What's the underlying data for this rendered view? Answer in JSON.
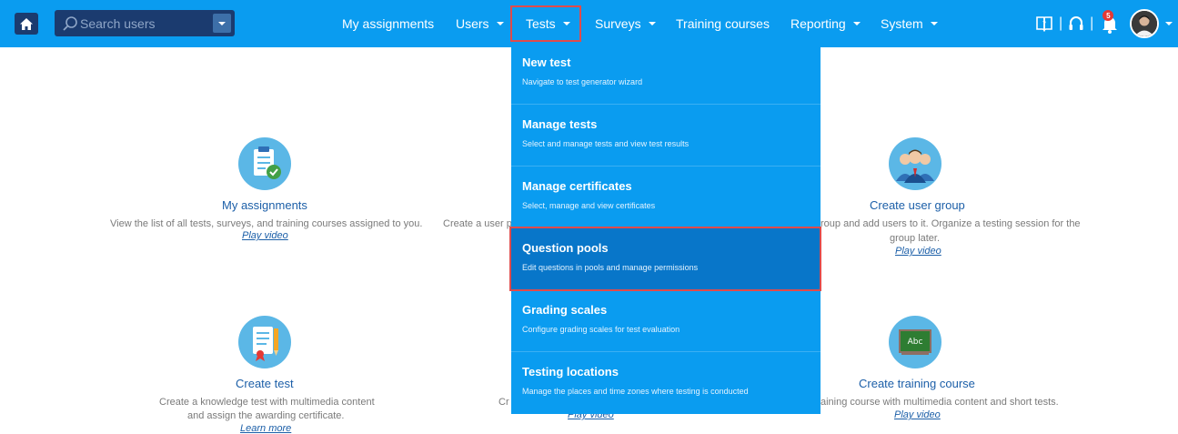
{
  "search": {
    "placeholder": "Search users"
  },
  "nav": {
    "my_assignments": "My assignments",
    "users": "Users",
    "tests": "Tests",
    "surveys": "Surveys",
    "training_courses": "Training courses",
    "reporting": "Reporting",
    "system": "System"
  },
  "notifications": {
    "count": "5"
  },
  "tests_menu": [
    {
      "title": "New test",
      "desc": "Navigate to test generator wizard"
    },
    {
      "title": "Manage tests",
      "desc": "Select and manage tests and view test results"
    },
    {
      "title": "Manage certificates",
      "desc": "Select, manage and view certificates"
    },
    {
      "title": "Question pools",
      "desc": "Edit questions in pools and manage permissions"
    },
    {
      "title": "Grading scales",
      "desc": "Configure grading scales for test evaluation"
    },
    {
      "title": "Testing locations",
      "desc": "Manage the places and time zones where testing is conducted"
    }
  ],
  "cards": {
    "my_assignments": {
      "title": "My assignments",
      "desc": "View the list of all tests, surveys, and training courses assigned to you.",
      "link": "Play video"
    },
    "create_user_partial": {
      "desc": "Create a user p"
    },
    "create_user_group": {
      "title": "Create user group",
      "desc1": "roup and add users to it. Organize a testing session for the",
      "desc2": "group later.",
      "link": "Play video"
    },
    "create_test": {
      "title": "Create test",
      "desc1": "Create a knowledge test with multimedia content",
      "desc2": "and assign the awarding certificate.",
      "link": "Learn more"
    },
    "create_survey_partial": {
      "desc": "Cr",
      "link": "Play video"
    },
    "create_training_course": {
      "title": "Create training course",
      "desc": "aining course with multimedia content and short tests.",
      "link": "Play video",
      "board_text": "Abc"
    }
  },
  "colors": {
    "nav_bg": "#0a9cf0",
    "dark": "#1b3b6f",
    "link": "#1c5fa8",
    "highlight": "#e04b4b",
    "active": "#0876c9"
  }
}
